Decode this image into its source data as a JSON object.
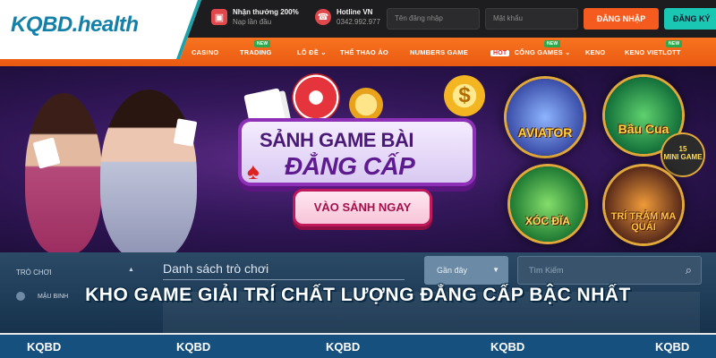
{
  "brand": {
    "logo": "KQBD.health"
  },
  "header": {
    "promo_title": "Nhận thưởng 200%",
    "promo_sub": "Nạp lần đầu",
    "hotline_title": "Hotline VN",
    "hotline_number": "0342.992.977",
    "username_placeholder": "Tên đăng nhập",
    "password_placeholder": "Mật khẩu",
    "login_label": "ĐĂNG NHẬP",
    "register_label": "ĐĂNG KÝ"
  },
  "nav": {
    "items": [
      "CASINO",
      "TRADING",
      "LÔ ĐỀ",
      "THỂ THAO ẢO",
      "NUMBERS GAME",
      "CỔNG GAMES",
      "KENO",
      "KENO VIETLOTT"
    ],
    "new_badge": "NEW",
    "hot_badge": "HOT"
  },
  "hero": {
    "title_line1": "SẢNH GAME BÀI",
    "title_line2": "ĐẲNG CẤP",
    "cta": "VÀO SẢNH NGAY",
    "coin_symbol": "$",
    "games": [
      "AVIATOR",
      "Bầu Cua",
      "XÓC ĐĨA",
      "TRÍ TRẢM MA QUÁI"
    ],
    "mini_game": "MINI GAME",
    "mini_num": "15"
  },
  "lower": {
    "sidebar_heading": "TRÒ CHƠI",
    "sidebar_item": "MẬU BINH",
    "list_title": "Danh sách trò chơi",
    "filter_value": "Gần đây",
    "search_placeholder": "Tìm Kiếm"
  },
  "headline": "KHO GAME GIẢI TRÍ CHẤT LƯỢNG ĐẲNG CẤP BẬC NHẤT",
  "footer": {
    "items": [
      "KQBD",
      "KQBD",
      "KQBD",
      "KQBD",
      "KQBD"
    ]
  },
  "colors": {
    "accent_orange": "#f55a1e",
    "accent_teal": "#19c7b2",
    "footer_blue": "#16507f",
    "logo_blue": "#1480a8"
  }
}
